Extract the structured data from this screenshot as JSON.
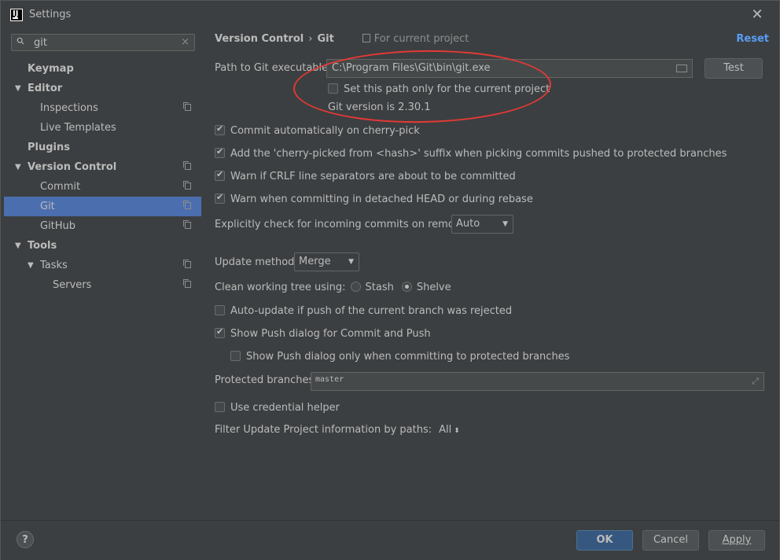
{
  "window": {
    "title": "Settings",
    "close_icon": "close-icon"
  },
  "search": {
    "value": "git",
    "clear": "×"
  },
  "sidebar": {
    "items": [
      {
        "label": "Keymap",
        "indent": 0,
        "bold": true,
        "toggle": "",
        "project_icon": false,
        "selected": false
      },
      {
        "label": "Editor",
        "indent": 0,
        "bold": true,
        "toggle": "▼",
        "project_icon": false,
        "selected": false
      },
      {
        "label": "Inspections",
        "indent": 1,
        "bold": false,
        "toggle": "",
        "project_icon": true,
        "selected": false
      },
      {
        "label": "Live Templates",
        "indent": 1,
        "bold": false,
        "toggle": "",
        "project_icon": false,
        "selected": false
      },
      {
        "label": "Plugins",
        "indent": 0,
        "bold": true,
        "toggle": "",
        "project_icon": false,
        "selected": false
      },
      {
        "label": "Version Control",
        "indent": 0,
        "bold": true,
        "toggle": "▼",
        "project_icon": true,
        "selected": false
      },
      {
        "label": "Commit",
        "indent": 1,
        "bold": false,
        "toggle": "",
        "project_icon": true,
        "selected": false
      },
      {
        "label": "Git",
        "indent": 1,
        "bold": false,
        "toggle": "",
        "project_icon": true,
        "selected": true
      },
      {
        "label": "GitHub",
        "indent": 1,
        "bold": false,
        "toggle": "",
        "project_icon": true,
        "selected": false
      },
      {
        "label": "Tools",
        "indent": 0,
        "bold": true,
        "toggle": "▼",
        "project_icon": false,
        "selected": false
      },
      {
        "label": "Tasks",
        "indent": 1,
        "bold": false,
        "toggle": "▼",
        "project_icon": true,
        "selected": false
      },
      {
        "label": "Servers",
        "indent": 2,
        "bold": false,
        "toggle": "",
        "project_icon": true,
        "selected": false
      }
    ]
  },
  "breadcrumb": {
    "parent": "Version Control",
    "separator": "›",
    "current": "Git",
    "scope": "For current project"
  },
  "reset_label": "Reset",
  "git_path": {
    "label": "Path to Git executable:",
    "value": "C:\\Program Files\\Git\\bin\\git.exe",
    "test_button": "Test",
    "project_only_label": "Set this path only for the current project",
    "project_only_checked": false,
    "version_text": "Git version is 2.30.1"
  },
  "options": {
    "cherry_pick": {
      "label": "Commit automatically on cherry-pick",
      "checked": true
    },
    "cherry_suffix": {
      "label": "Add the 'cherry-picked from <hash>' suffix when picking commits pushed to protected branches",
      "checked": true
    },
    "crlf": {
      "label": "Warn if CRLF line separators are about to be committed",
      "checked": true
    },
    "detached": {
      "label": "Warn when committing in detached HEAD or during rebase",
      "checked": true
    },
    "incoming_label": "Explicitly check for incoming commits on remotes:",
    "incoming_value": "Auto",
    "update_method_label": "Update method:",
    "update_method_value": "Merge",
    "clean_tree_label": "Clean working tree using:",
    "stash_label": "Stash",
    "shelve_label": "Shelve",
    "clean_tree_selected": "Shelve",
    "auto_update": {
      "label": "Auto-update if push of the current branch was rejected",
      "checked": false
    },
    "show_push": {
      "label": "Show Push dialog for Commit and Push",
      "checked": true
    },
    "show_push_protected": {
      "label": "Show Push dialog only when committing to protected branches",
      "checked": false
    },
    "protected_label": "Protected branches:",
    "protected_value": "master",
    "credential": {
      "label": "Use credential helper",
      "checked": false
    },
    "filter_label": "Filter Update Project information by paths:",
    "filter_value": "All"
  },
  "footer": {
    "help": "?",
    "ok": "OK",
    "cancel": "Cancel",
    "apply": "Apply"
  },
  "colors": {
    "background": "#3c3f41",
    "selection": "#4b6eaf",
    "link": "#589df6",
    "annotation": "#e53935"
  }
}
